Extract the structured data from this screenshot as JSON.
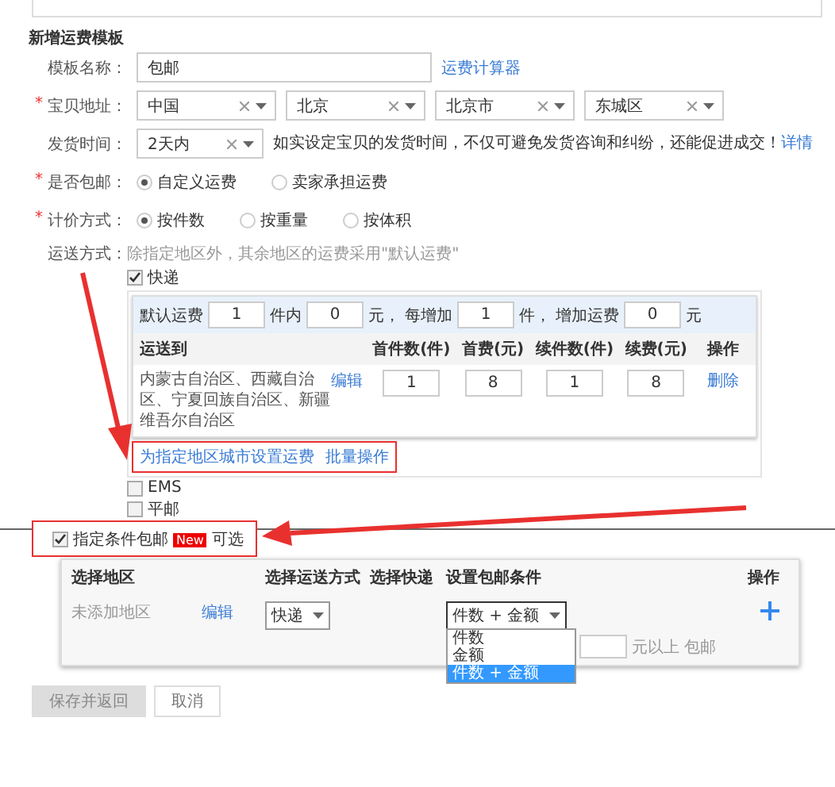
{
  "section_title": "新增运费模板",
  "name_row": {
    "label": "模板名称：",
    "value": "包邮",
    "link": "运费计算器"
  },
  "address_row": {
    "mark": "*",
    "label": "宝贝地址：",
    "selects": [
      "中国",
      "北京",
      "北京市",
      "东城区"
    ]
  },
  "ship_time_row": {
    "label": "发货时间：",
    "value": "2天内",
    "hint": "如实设定宝贝的发货时间，不仅可避免发货咨询和纠纷，还能促进成交！",
    "link": "详情"
  },
  "free_shipping_row": {
    "mark": "*",
    "label": "是否包邮：",
    "options": [
      {
        "label": "自定义运费",
        "selected": true
      },
      {
        "label": "卖家承担运费",
        "selected": false
      }
    ]
  },
  "pricing_row": {
    "mark": "*",
    "label": "计价方式：",
    "options": [
      {
        "label": "按件数",
        "selected": true
      },
      {
        "label": "按重量",
        "selected": false
      },
      {
        "label": "按体积",
        "selected": false
      }
    ]
  },
  "delivery_row": {
    "label": "运送方式：",
    "hint": "除指定地区外，其余地区的运费采用\"默认运费\"",
    "methods": [
      {
        "label": "快递",
        "checked": true,
        "expanded": true
      },
      {
        "label": "EMS",
        "checked": false,
        "expanded": false
      },
      {
        "label": "平邮",
        "checked": false,
        "expanded": false
      }
    ]
  },
  "express_panel": {
    "default_fee": [
      {
        "kind": "label",
        "text": "默认运费"
      },
      {
        "kind": "input",
        "text": "1"
      },
      {
        "kind": "label",
        "text": "件内"
      },
      {
        "kind": "input",
        "text": "0"
      },
      {
        "kind": "label",
        "text": "元，"
      },
      {
        "kind": "label",
        "text": "每增加"
      },
      {
        "kind": "input",
        "text": "1"
      },
      {
        "kind": "label",
        "text": "件，"
      },
      {
        "kind": "label",
        "text": "增加运费"
      },
      {
        "kind": "input",
        "text": "0"
      },
      {
        "kind": "label",
        "text": "元"
      }
    ],
    "columns": [
      "运送到",
      "首件数(件)",
      "首费(元)",
      "续件数(件)",
      "续费(元)",
      "操作"
    ],
    "rows": [
      {
        "regions": "内蒙古自治区、西藏自治区、宁夏回族自治区、新疆维吾尔自治区",
        "edit": "编辑",
        "values": [
          "1",
          "8",
          "1",
          "8"
        ],
        "action": "删除"
      }
    ],
    "links": [
      "为指定地区城市设置运费",
      "批量操作"
    ],
    "highlighted": true
  },
  "conditional_free": {
    "checked": true,
    "label": "指定条件包邮",
    "badge": "New",
    "suffix": "可选",
    "highlighted": true,
    "columns": {
      "region": "选择地区",
      "method": "选择运送方式",
      "courier": "选择快递",
      "condition": "设置包邮条件",
      "action": "操作"
    },
    "rows": [
      {
        "region": "未添加地区",
        "edit": "编辑",
        "method": "快递",
        "condition": "件数 + 金额",
        "dropdown_open": true,
        "options": [
          {
            "label": "件数",
            "selected": false
          },
          {
            "label": "金额",
            "selected": false
          },
          {
            "label": "件数 + 金额",
            "selected": true
          }
        ],
        "amount_suffix": "元以上 包邮"
      }
    ]
  },
  "buttons": [
    {
      "label": "保存并返回",
      "disabled": true
    },
    {
      "label": "取消",
      "disabled": false
    }
  ]
}
